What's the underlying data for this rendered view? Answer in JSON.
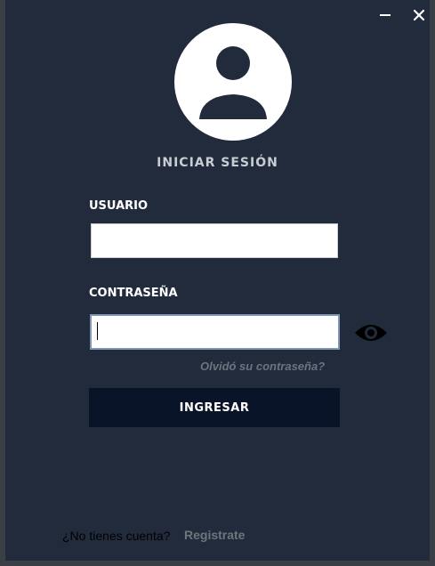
{
  "window": {
    "minimize_icon": "minimize-icon",
    "close_icon": "close-icon"
  },
  "header": {
    "avatar_icon": "user-avatar-icon",
    "title": "INICIAR SESIÓN"
  },
  "form": {
    "username_label": "USUARIO",
    "username_value": "",
    "password_label": "CONTRASEÑA",
    "password_value": "",
    "show_password_icon": "eye-icon",
    "forgot_password": "Olvidó su contraseña?",
    "submit_label": "INGRESAR"
  },
  "footer": {
    "question": "¿No tienes cuenta?",
    "register_link": "Registrate"
  },
  "colors": {
    "panel": "#222b3c",
    "frame": "#3a3f45",
    "button": "#0a1429",
    "muted_link": "#6c7480"
  }
}
